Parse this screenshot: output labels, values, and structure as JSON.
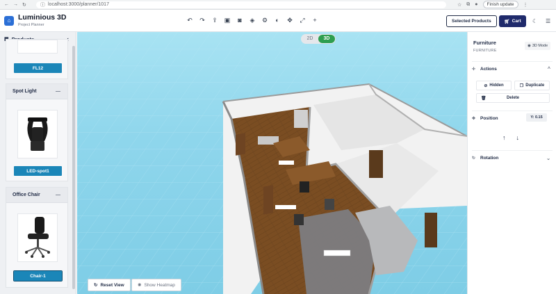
{
  "browser": {
    "url": "localhost:3000/planner/1017",
    "update_label": "Finish update"
  },
  "app": {
    "title": "Luminious 3D",
    "subtitle": "Project Planner"
  },
  "toolbar": {
    "selected_products_label": "Selected Products",
    "cart_label": "Cart",
    "tool_icons": [
      "undo-icon",
      "redo-icon",
      "upload-icon",
      "save-icon",
      "camera-icon",
      "layers-icon",
      "settings-icon",
      "palette-icon",
      "move-icon",
      "expand-icon",
      "plus-icon"
    ]
  },
  "sidebar": {
    "title": "Products",
    "items": [
      {
        "button_label": "FL12"
      },
      {
        "category": "Spot Light",
        "button_label": "LED-spot1"
      },
      {
        "category": "Office Chair",
        "button_label": "Chair-1"
      }
    ]
  },
  "viewport": {
    "mode_2d": "2D",
    "mode_3d": "3D",
    "active_mode": "3D",
    "reset_view_label": "Reset View",
    "heatmap_label": "Show Heatmap"
  },
  "panel": {
    "title": "Furniture",
    "subtitle": "FURNITURE",
    "mode_badge": "3D Mode",
    "actions": {
      "title": "Actions",
      "hidden_label": "Hidden",
      "duplicate_label": "Duplicate",
      "delete_label": "Delete"
    },
    "position": {
      "title": "Position",
      "y_value": "Y: 0.15"
    },
    "rotation": {
      "title": "Rotation"
    }
  },
  "colors": {
    "accent": "#1b86b8",
    "primary": "#1f2a6b",
    "toggle_active": "#2e9e4f",
    "sky": "#8fd6ec"
  }
}
